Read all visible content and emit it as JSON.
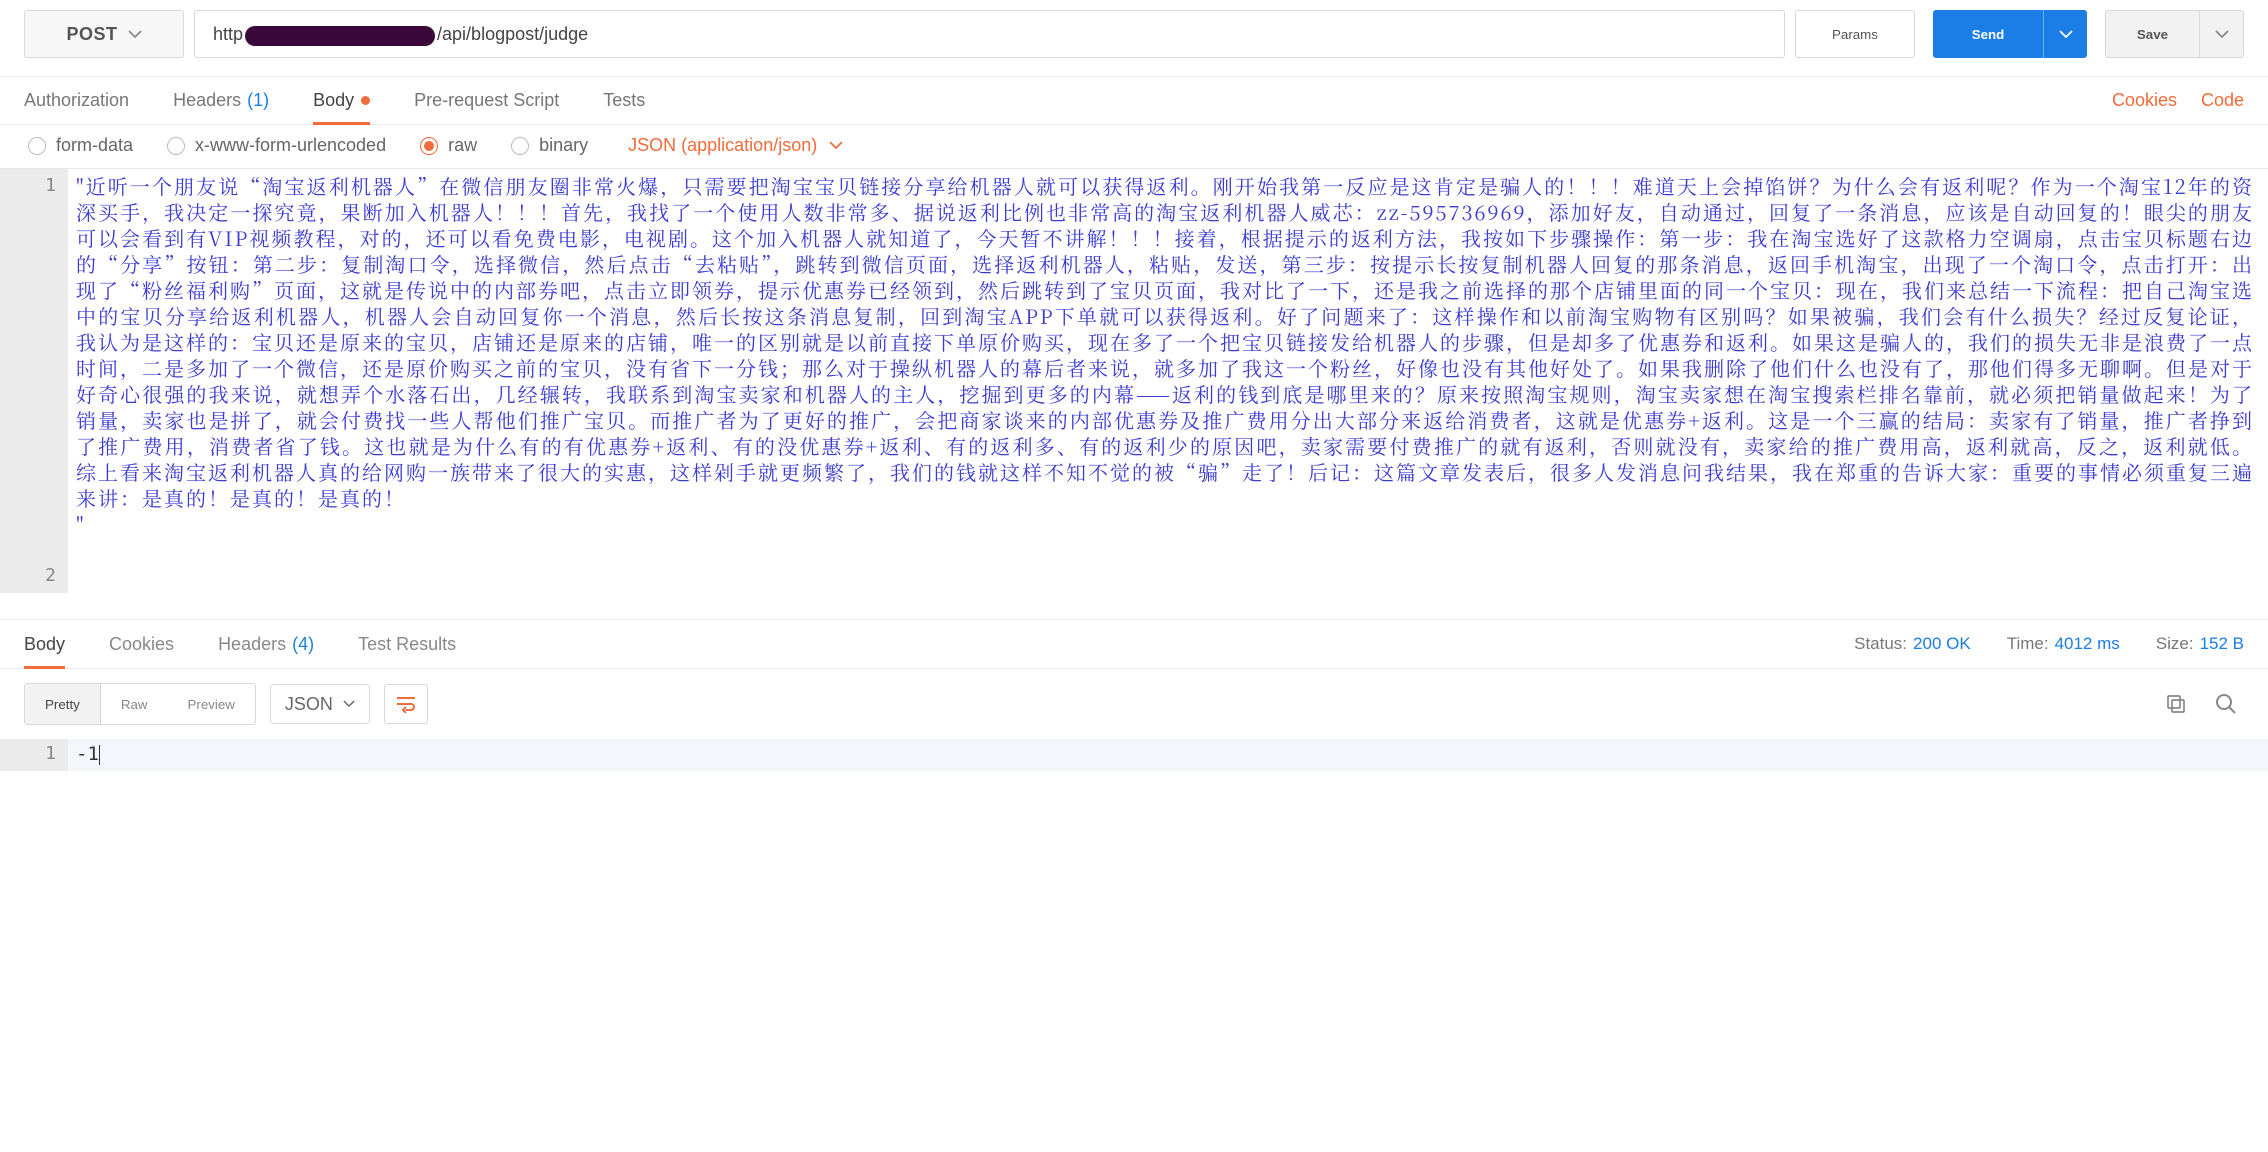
{
  "request": {
    "method": "POST",
    "url_prefix": "http",
    "url_suffix": "/api/blogpost/judge",
    "params_btn": "Params",
    "send_btn": "Send",
    "save_btn": "Save"
  },
  "tabs": {
    "authorization": "Authorization",
    "headers": "Headers",
    "headers_count": "(1)",
    "body": "Body",
    "prerequest": "Pre-request Script",
    "tests": "Tests"
  },
  "links": {
    "cookies": "Cookies",
    "code": "Code"
  },
  "body_types": {
    "form_data": "form-data",
    "urlencoded": "x-www-form-urlencoded",
    "raw": "raw",
    "binary": "binary",
    "content_type": "JSON (application/json)"
  },
  "editor": {
    "line1": "1",
    "line2": "2",
    "text": "\"近听一个朋友说“淘宝返利机器人”在微信朋友圈非常火爆，只需要把淘宝宝贝链接分享给机器人就可以获得返利。刚开始我第一反应是这肯定是骗人的！！！难道天上会掉馅饼？为什么会有返利呢？作为一个淘宝12年的资深买手，我决定一探究竟，果断加入机器人！！！首先，我找了一个使用人数非常多、据说返利比例也非常高的淘宝返利机器人威芯：zz-595736969，添加好友，自动通过，回复了一条消息，应该是自动回复的！眼尖的朋友可以会看到有VIP视频教程，对的，还可以看免费电影，电视剧。这个加入机器人就知道了，今天暂不讲解！！！接着，根据提示的返利方法，我按如下步骤操作：第一步：我在淘宝选好了这款格力空调扇，点击宝贝标题右边的“分享”按钮：第二步：复制淘口令，选择微信，然后点击“去粘贴”，跳转到微信页面，选择返利机器人，粘贴，发送，第三步：按提示长按复制机器人回复的那条消息，返回手机淘宝，出现了一个淘口令，点击打开：出现了“粉丝福利购”页面，这就是传说中的内部券吧，点击立即领券，提示优惠券已经领到，然后跳转到了宝贝页面，我对比了一下，还是我之前选择的那个店铺里面的同一个宝贝：现在，我们来总结一下流程：把自己淘宝选中的宝贝分享给返利机器人，机器人会自动回复你一个消息，然后长按这条消息复制，回到淘宝APP下单就可以获得返利。好了问题来了：这样操作和以前淘宝购物有区别吗？如果被骗，我们会有什么损失？经过反复论证，我认为是这样的：宝贝还是原来的宝贝，店铺还是原来的店铺，唯一的区别就是以前直接下单原价购买，现在多了一个把宝贝链接发给机器人的步骤，但是却多了优惠券和返利。如果这是骗人的，我们的损失无非是浪费了一点时间，二是多加了一个微信，还是原价购买之前的宝贝，没有省下一分钱；那么对于操纵机器人的幕后者来说，就多加了我这一个粉丝，好像也没有其他好处了。如果我删除了他们什么也没有了，那他们得多无聊啊。但是对于好奇心很强的我来说，就想弄个水落石出，几经辗转，我联系到淘宝卖家和机器人的主人，挖掘到更多的内幕——返利的钱到底是哪里来的？原来按照淘宝规则，淘宝卖家想在淘宝搜索栏排名靠前，就必须把销量做起来！为了销量，卖家也是拼了，就会付费找一些人帮他们推广宝贝。而推广者为了更好的推广，会把商家谈来的内部优惠券及推广费用分出大部分来返给消费者，这就是优惠券+返利。这是一个三赢的结局：卖家有了销量，推广者挣到了推广费用，消费者省了钱。这也就是为什么有的有优惠券+返利、有的没优惠券+返利、有的返利多、有的返利少的原因吧，卖家需要付费推广的就有返利，否则就没有，卖家给的推广费用高，返利就高，反之，返利就低。综上看来淘宝返利机器人真的给网购一族带来了很大的实惠，这样剁手就更频繁了，我们的钱就这样不知不觉的被“骗”走了！后记：这篇文章发表后，很多人发消息问我结果，我在郑重的告诉大家：重要的事情必须重复三遍来讲：是真的！是真的！是真的！",
    "closing_quote": "\""
  },
  "response_tabs": {
    "body": "Body",
    "cookies": "Cookies",
    "headers": "Headers",
    "headers_count": "(4)",
    "tests": "Test Results"
  },
  "response_meta": {
    "status_label": "Status:",
    "status_value": "200 OK",
    "time_label": "Time:",
    "time_value": "4012 ms",
    "size_label": "Size:",
    "size_value": "152 B"
  },
  "response_tools": {
    "pretty": "Pretty",
    "raw": "Raw",
    "preview": "Preview",
    "format": "JSON"
  },
  "response_body": {
    "line1": "1",
    "text": "-1"
  }
}
